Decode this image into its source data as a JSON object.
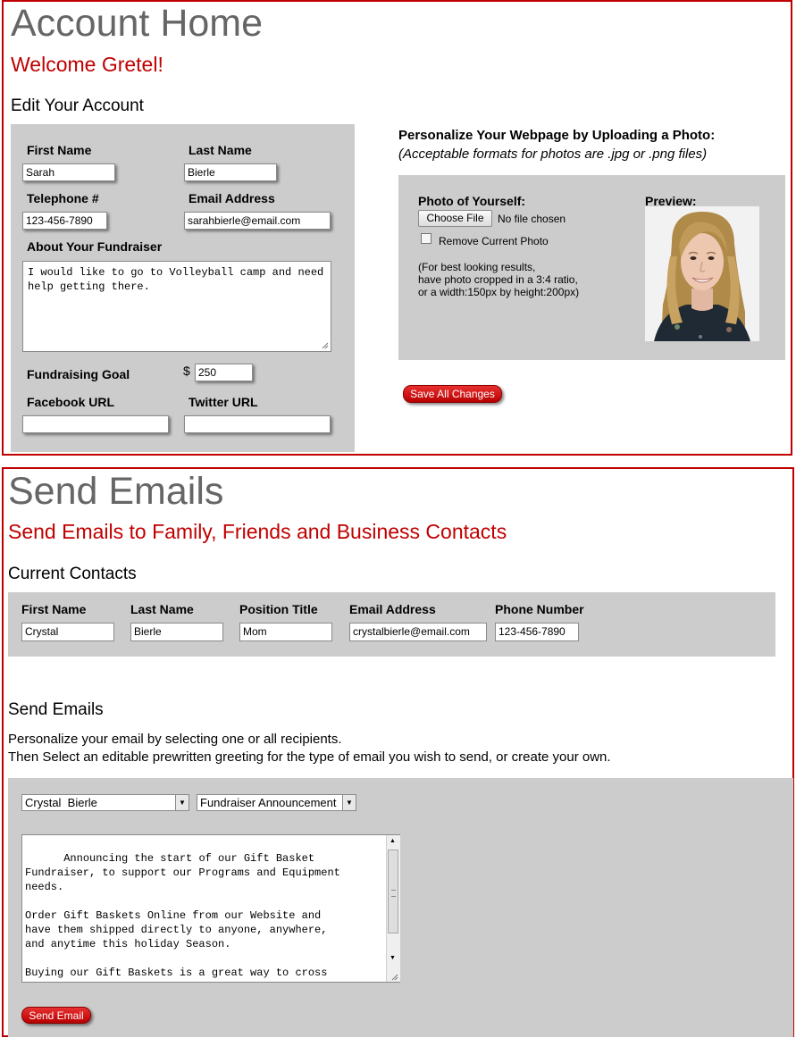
{
  "account": {
    "title": "Account Home",
    "welcome": "Welcome Gretel!",
    "edit_heading": "Edit Your Account",
    "fields": {
      "first_name_label": "First Name",
      "first_name_value": "Sarah",
      "last_name_label": "Last Name",
      "last_name_value": "Bierle",
      "telephone_label": "Telephone #",
      "telephone_value": "123-456-7890",
      "email_label": "Email Address",
      "email_value": "sarahbierle@email.com",
      "about_label": "About Your Fundraiser",
      "about_value": "I would like to go to Volleyball camp and need help getting there.",
      "goal_label": "Fundraising Goal",
      "goal_currency": "$",
      "goal_value": "250",
      "facebook_label": "Facebook URL",
      "facebook_value": "",
      "twitter_label": "Twitter URL",
      "twitter_value": ""
    },
    "photo": {
      "heading": "Personalize Your Webpage by Uploading a Photo:",
      "formats_note": "(Acceptable formats for photos are .jpg or .png files)",
      "photo_label": "Photo of Yourself:",
      "choose_file_label": "Choose File",
      "no_file_text": "No file chosen",
      "remove_label": "Remove Current Photo",
      "remove_checked": false,
      "hint_line1": "(For best looking results,",
      "hint_line2": "have photo cropped in a 3:4 ratio,",
      "hint_line3": "or a width:150px by height:200px)",
      "preview_label": "Preview:"
    },
    "save_label": "Save All Changes"
  },
  "emails": {
    "title": "Send Emails",
    "subtitle": "Send Emails to Family, Friends and Business Contacts",
    "contacts_heading": "Current Contacts",
    "contact_columns": [
      "First Name",
      "Last Name",
      "Position Title",
      "Email Address",
      "Phone Number"
    ],
    "contact_row": [
      "Crystal",
      "Bierle",
      "Mom",
      "crystalbierle@email.com",
      "123-456-7890"
    ],
    "send_heading": "Send Emails",
    "instructions_line1": "Personalize your email by selecting one or all recipients.",
    "instructions_line2": "Then Select an editable prewritten greeting for the type of email you wish to send, or create your own.",
    "recipient_selected": "Crystal  Bierle",
    "greeting_selected": "Fundraiser Announcement",
    "message_body": "Announcing the start of our Gift Basket\nFundraiser, to support our Programs and Equipment\nneeds.\n\nOrder Gift Baskets Online from our Website and\nhave them shipped directly to anyone, anywhere,\nand anytime this holiday Season.\n\nBuying our Gift Baskets is a great way to cross\neveryone off your Holiday To-Do List while",
    "send_label": "Send Email"
  }
}
